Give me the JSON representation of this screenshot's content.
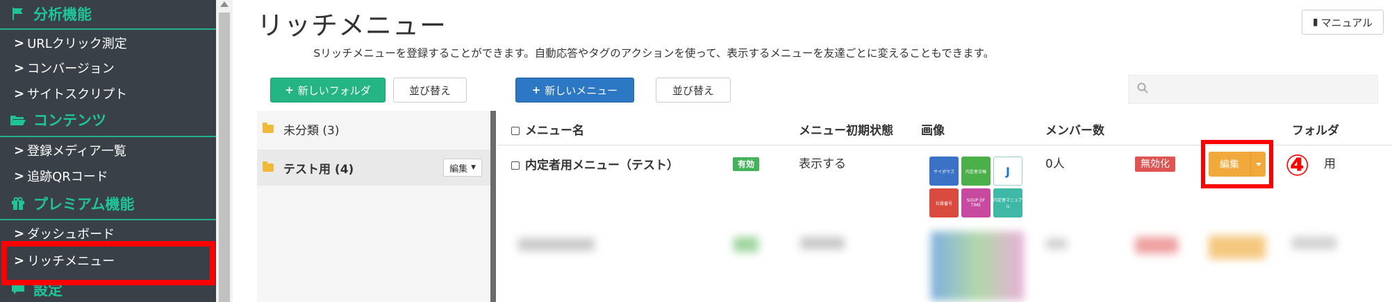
{
  "sidebar": {
    "sections": [
      {
        "label": "分析機能",
        "icon": "flag-icon"
      },
      {
        "label": "コンテンツ",
        "icon": "folder-open-icon"
      },
      {
        "label": "プレミアム機能",
        "icon": "gift-icon"
      },
      {
        "label": "設定",
        "icon": "comment-icon"
      }
    ],
    "items": [
      {
        "label": "URLクリック測定"
      },
      {
        "label": "コンバージョン"
      },
      {
        "label": "サイトスクリプト"
      },
      {
        "label": "登録メディア一覧"
      },
      {
        "label": "追跡QRコード"
      },
      {
        "label": "ダッシュボード"
      },
      {
        "label": "リッチメニュー"
      }
    ],
    "chevron": ">"
  },
  "header": {
    "title": "リッチメニュー",
    "manual_label": "マニュアル",
    "description": "　　　 Sリッチメニューを登録することができます。自動応答やタグのアクションを使って、表示するメニューを友達ごとに変えることもできます。"
  },
  "toolbar": {
    "new_folder_label": "新しいフォルダ",
    "sort_folders_label": "並び替え",
    "new_menu_label": "新しいメニュー",
    "sort_menus_label": "並び替え",
    "search_placeholder": ""
  },
  "folders": [
    {
      "label": "未分類 (3)"
    },
    {
      "label": "テスト用 (4)",
      "edit_label": "編集"
    }
  ],
  "table": {
    "columns": {
      "name": "メニュー名",
      "initial_state": "メニュー初期状態",
      "image": "画像",
      "members": "メンバー数",
      "folder": "フォルダ"
    },
    "row": {
      "name": "内定者用メニュー（テスト）",
      "status_badge": "有効",
      "initial_state": "表示する",
      "members": "0人",
      "disable_label": "無効化",
      "edit_label": "編集",
      "folder": "用"
    },
    "rich_menu_tiles": [
      {
        "label": "サイボウズ",
        "color": "#3b72c6"
      },
      {
        "label": "内定者日報",
        "color": "#4cb04a"
      },
      {
        "label": "J",
        "color": "#ffffff"
      },
      {
        "label": "社員番号",
        "color": "#d94b3f"
      },
      {
        "label": "SOUP OF TIME",
        "color": "#c84aa0"
      },
      {
        "label": "内定者マニュアル",
        "color": "#3fb8a8"
      }
    ]
  },
  "annotation": {
    "step_number": "④"
  },
  "colors": {
    "sidebar_bg": "#3a4048",
    "sidebar_accent": "#1fc49a",
    "green_button": "#25b585",
    "blue_button": "#2c78c4",
    "edit_button": "#f2a93b",
    "highlight": "#ff0000"
  }
}
